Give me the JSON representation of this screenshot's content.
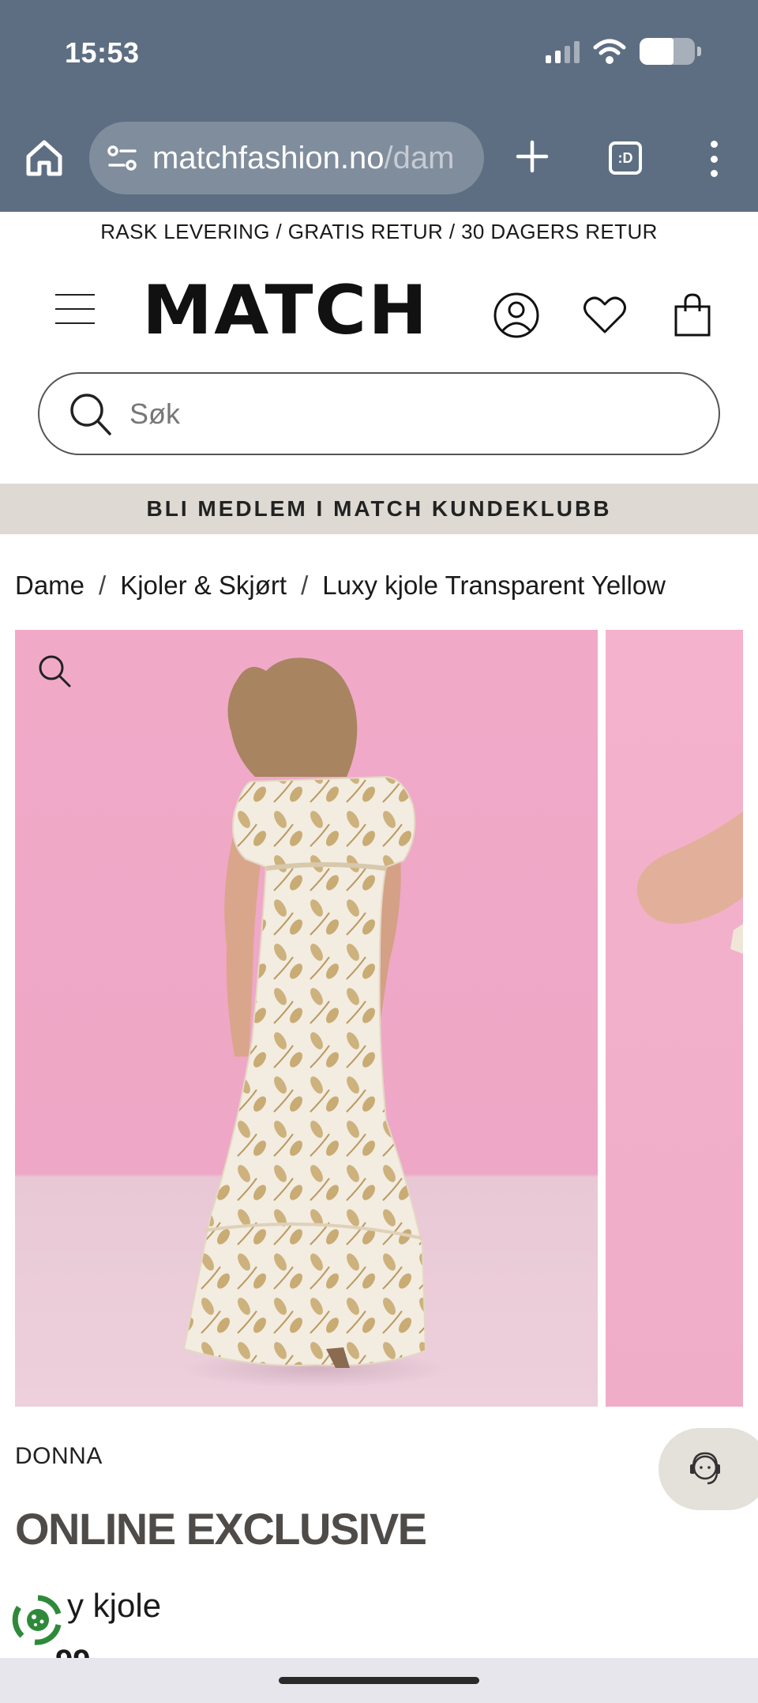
{
  "status_bar": {
    "time": "15:53"
  },
  "browser": {
    "url_host": "matchfashion.no",
    "url_path": "/dam",
    "tabs_label": ":D"
  },
  "announcement": "RASK LEVERING / GRATIS RETUR / 30 DAGERS RETUR",
  "header": {
    "logo": "MATCH"
  },
  "search": {
    "placeholder": "Søk"
  },
  "club_banner": "BLI MEDLEM I MATCH KUNDEKLUBB",
  "breadcrumb": [
    "Dame",
    "Kjoler & Skjørt",
    "Luxy kjole Transparent Yellow"
  ],
  "breadcrumb_separator": "/",
  "product": {
    "brand": "DONNA",
    "badge": "ONLINE EXCLUSIVE",
    "name_visible": "y kjole",
    "price_peek": "…99"
  },
  "colors": {
    "chrome": "#5d6e82",
    "club_banner": "#ded9d3",
    "photo_background": "#f0aac8",
    "chat_button": "#e4e0da",
    "cookie_icon": "#2e8a3a"
  }
}
